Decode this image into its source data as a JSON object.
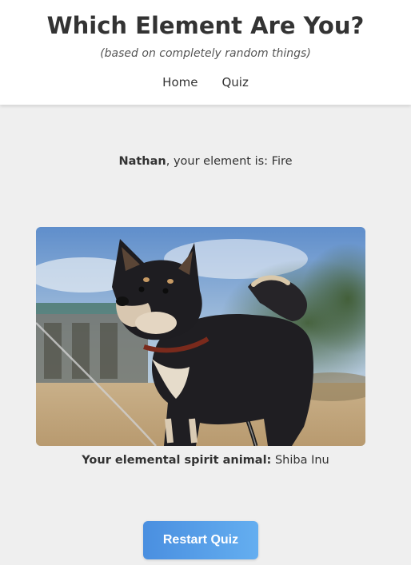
{
  "header": {
    "title": "Which Element Are You?",
    "subtitle": "(based on completely random things)",
    "nav": [
      {
        "label": "Home"
      },
      {
        "label": "Quiz"
      }
    ]
  },
  "result": {
    "name": "Nathan",
    "text": ", your element is: ",
    "element": "Fire"
  },
  "spirit_animal": {
    "label": "Your elemental spirit animal:",
    "value": "Shiba Inu"
  },
  "restart_button": {
    "label": "Restart Quiz"
  },
  "colors": {
    "page_background": "#efefef",
    "header_background": "#ffffff",
    "button_gradient_start": "#4a8fe0",
    "button_gradient_end": "#64aef0"
  }
}
